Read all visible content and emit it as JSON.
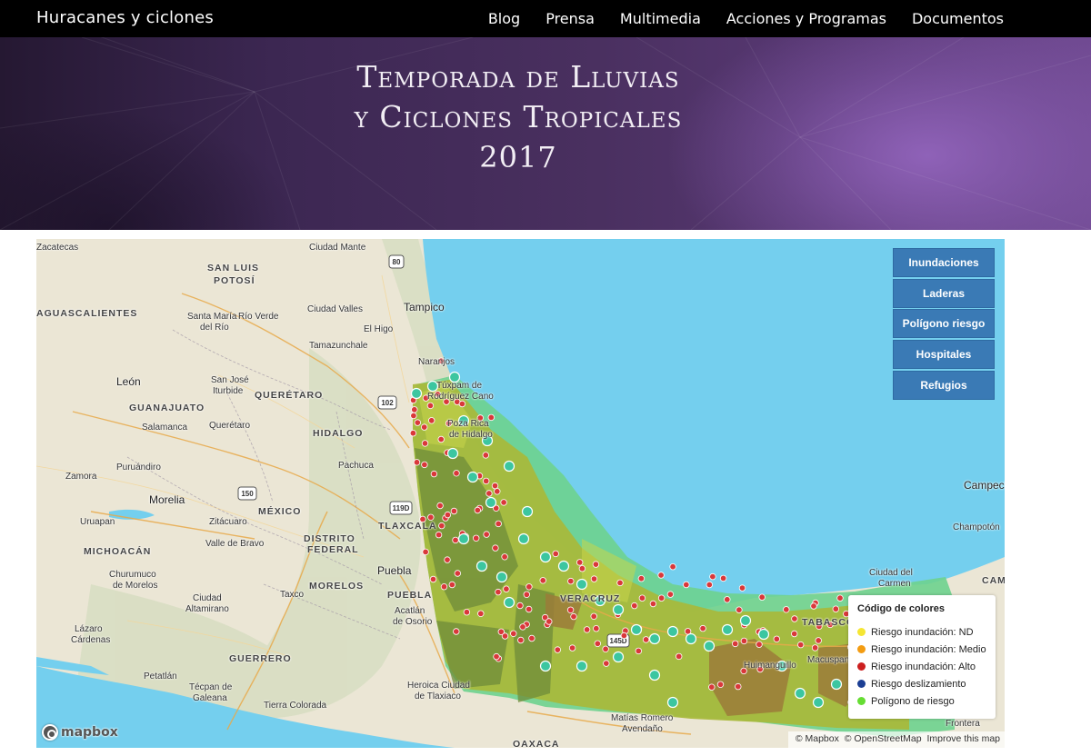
{
  "navbar": {
    "brand": "Huracanes y ciclones",
    "items": [
      "Blog",
      "Prensa",
      "Multimedia",
      "Acciones y Programas",
      "Documentos"
    ]
  },
  "hero": {
    "line1": "Temporada de Lluvias",
    "line2": "y Ciclones Tropicales",
    "line3": "2017"
  },
  "map": {
    "layer_buttons": [
      "Inundaciones",
      "Laderas",
      "Polígono riesgo",
      "Hospitales",
      "Refugios"
    ],
    "legend": {
      "title": "Código de colores",
      "items": [
        {
          "label": "Riesgo inundación: ND",
          "color": "#f5e633"
        },
        {
          "label": "Riesgo inundación: Medio",
          "color": "#f39c12"
        },
        {
          "label": "Riesgo inundación: Alto",
          "color": "#cc1f1f"
        },
        {
          "label": "Riesgo deslizamiento",
          "color": "#1c3f94"
        },
        {
          "label": "Polígono de riesgo",
          "color": "#66dd33"
        }
      ]
    },
    "labels": {
      "zacatecas": "Zacatecas",
      "ciudad_mante": "Ciudad Mante",
      "san_luis": "SAN LUIS",
      "potosi": "POTOSÍ",
      "aguascalientes": "AGUASCALIENTES",
      "santa_maria": "Santa María",
      "del_rio": "del Río",
      "rio_verde": "Río Verde",
      "ciudad_valles": "Ciudad Valles",
      "tampico": "Tampico",
      "el_higo": "El Higo",
      "naranjos": "Naranjos",
      "tamazunchale": "Tamazunchale",
      "leon": "León",
      "guanajuato": "GUANAJUATO",
      "san_jose": "San José",
      "iturbide": "Iturbide",
      "queretaro_state": "QUERÉTARO",
      "hidalgo": "HIDALGO",
      "salamanca": "Salamanca",
      "queretaro": "Querétaro",
      "zamora": "Zamora",
      "puruandiro": "Puruándiro",
      "pachuca": "Pachuca",
      "morelia": "Morelia",
      "mexico": "MÉXICO",
      "tlaxcala": "TLAXCALA",
      "uruapan": "Uruapan",
      "zitacuaro": "Zitácuaro",
      "distrito": "DISTRITO",
      "federal": "FEDERAL",
      "michoacan": "MICHOACÁN",
      "valle_bravo": "Valle de Bravo",
      "churumuco": "Churumuco",
      "de_morelos": "de Morelos",
      "morelos": "MORELOS",
      "puebla": "Puebla",
      "puebla_state": "PUEBLA",
      "taxco": "Taxco",
      "acatlan": "Acatlán",
      "de_osorio": "de Osorio",
      "ciudad": "Ciudad",
      "altamirano": "Altamirano",
      "lazaro": "Lázaro",
      "cardenas": "Cárdenas",
      "guerrero": "GUERRERO",
      "petatlan": "Petatlán",
      "tecpan": "Técpan de",
      "galeana": "Galeana",
      "tierra_colorada": "Tierra Colorada",
      "heroica": "Heroica Ciudad",
      "tlaxiaco": "de Tlaxiaco",
      "matias": "Matías Romero",
      "avendano": "Avendaño",
      "oaxaca": "OAXACA",
      "campeche": "Campeche",
      "champoton": "Champotón",
      "ciudad_del": "Ciudad del",
      "carmen": "Carmen",
      "cam": "CAM",
      "tabasco": "TABASCO",
      "frontera": "Frontera",
      "veracruz": "VERACRUZ",
      "tuxpam": "Túxpam de",
      "rodriguez": "Rodríguez Cano",
      "poza_rica": "Poza Rica",
      "de_hidalgo": "de Hidalgo",
      "humanguillo": "Huimanguillo",
      "macuspana": "Macuspana"
    },
    "highway_shields": [
      "80",
      "102",
      "150",
      "119D",
      "145D"
    ],
    "logo": "mapbox",
    "attribution": [
      "© Mapbox",
      "© OpenStreetMap",
      "Improve this map"
    ]
  }
}
